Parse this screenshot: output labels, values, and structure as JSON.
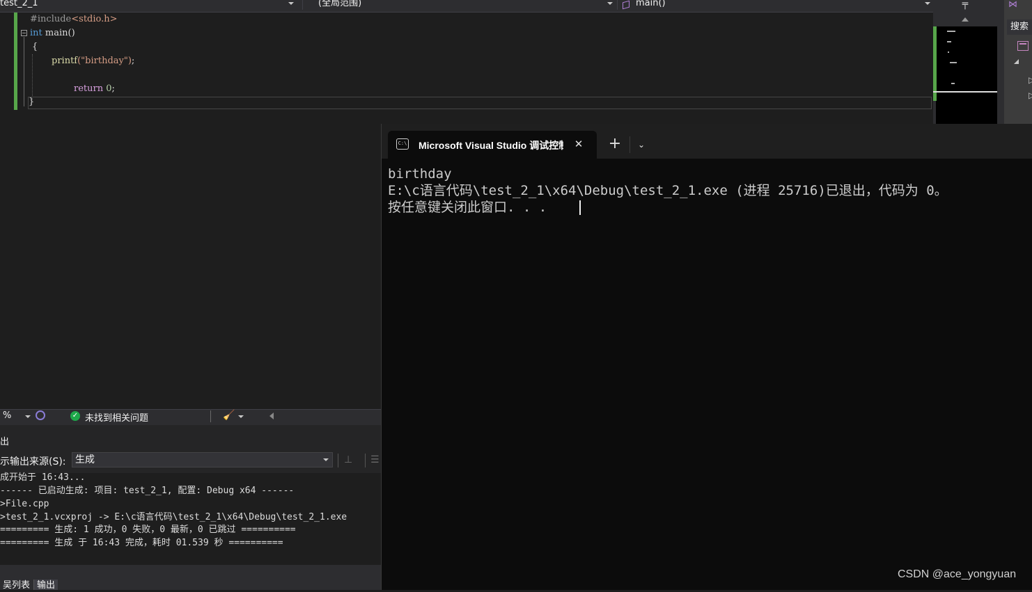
{
  "nav": {
    "project": "test_2_1",
    "scope": "(全局范围)",
    "member": "main()"
  },
  "code": {
    "line1_pp": "#include",
    "line1_inc": "<stdio.h>",
    "line2_kw": "int",
    "line2_rest": " main()",
    "line3": "{",
    "line4_fn": "printf",
    "line4_str": "(\"birthday\")",
    "line4_end": ";",
    "line6_kw": "return",
    "line6_num": " 0",
    "line6_end": ";",
    "line7": "}"
  },
  "sidebar": {
    "search_label": "搜索"
  },
  "status": {
    "zoom": "%",
    "issues": "未找到相关问题"
  },
  "output": {
    "title": "出",
    "source_label": "示输出来源(S):",
    "source_value": "生成",
    "lines": [
      "成开始于 16:43...",
      "------ 已启动生成: 项目: test_2_1, 配置: Debug x64 ------",
      ">File.cpp",
      ">test_2_1.vcxproj -> E:\\c语言代码\\test_2_1\\x64\\Debug\\test_2_1.exe",
      "========= 生成: 1 成功，0 失败，0 最新，0 已跳过 ==========",
      "========= 生成 于 16:43 完成，耗时 01.539 秒 =========="
    ],
    "tabs": [
      "吴列表",
      "输出"
    ]
  },
  "console": {
    "tab_title": "Microsoft Visual Studio 调试控制台",
    "lines": [
      "birthday",
      "E:\\c语言代码\\test_2_1\\x64\\Debug\\test_2_1.exe (进程 25716)已退出，代码为 0。",
      "按任意键关闭此窗口. . ."
    ]
  },
  "watermark": "CSDN @ace_yongyuan",
  "colors": {
    "change_bar": "#57a64a",
    "keyword": "#569cd6",
    "string": "#d69d85",
    "control_keyword": "#d8a0df",
    "function": "#dcdcaa",
    "console_bg": "#0c0c0c",
    "success_check": "#1ea84a"
  },
  "icons": [
    "chevron-down-icon",
    "cube-icon",
    "split-icon",
    "visual-studio-icon",
    "panel-icon",
    "check-circle-icon",
    "broom-icon",
    "console-icon",
    "close-icon",
    "plus-icon"
  ]
}
